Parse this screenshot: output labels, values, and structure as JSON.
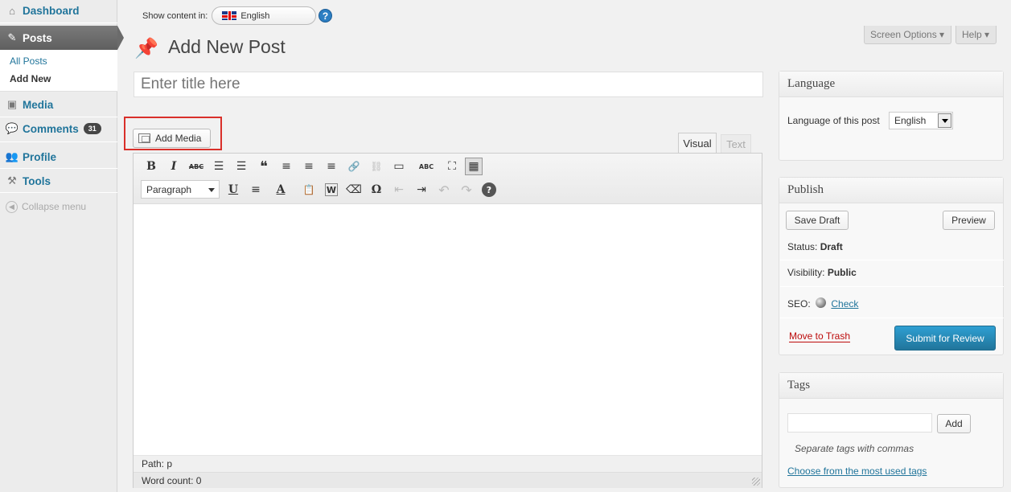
{
  "sidebar": {
    "dashboard": "Dashboard",
    "posts": "Posts",
    "all_posts": "All Posts",
    "add_new": "Add New",
    "media": "Media",
    "comments": "Comments",
    "comments_count": "31",
    "profile": "Profile",
    "tools": "Tools",
    "collapse": "Collapse menu"
  },
  "topbar": {
    "show_content_label": "Show content in:",
    "language": "English",
    "help_icon": "?",
    "screen_options": "Screen Options ▾",
    "help": "Help ▾"
  },
  "page": {
    "title": "Add New Post",
    "title_placeholder": "Enter title here"
  },
  "editor": {
    "add_media": "Add Media",
    "tab_visual": "Visual",
    "tab_text": "Text",
    "format": "Paragraph",
    "path": "Path: p",
    "word_count": "Word count: 0",
    "buttons": {
      "bold": "B",
      "italic": "I",
      "strike": "ABC",
      "bullets": "☰",
      "numbers": "☰",
      "quote": "❝",
      "align_left": "≡",
      "align_center": "≡",
      "align_right": "≡",
      "link": "🔗",
      "unlink": "⛓",
      "more": "▭",
      "spell": "ABC",
      "fullscreen": "⛶",
      "kitchen": "▦",
      "underline": "U",
      "justify": "≡",
      "text_color": "A",
      "paste_text": "📋",
      "paste_word": "W",
      "clear": "⌫",
      "omega": "Ω",
      "outdent": "⇤",
      "indent": "⇥",
      "undo": "↶",
      "redo": "↷",
      "help": "?"
    }
  },
  "language_box": {
    "title": "Language",
    "label": "Language of this post",
    "value": "English"
  },
  "publish_box": {
    "title": "Publish",
    "save_draft": "Save Draft",
    "preview": "Preview",
    "status_label": "Status:",
    "status_value": "Draft",
    "visibility_label": "Visibility:",
    "visibility_value": "Public",
    "seo_label": "SEO:",
    "seo_link": "Check",
    "trash": "Move to Trash",
    "submit": "Submit for Review"
  },
  "tags_box": {
    "title": "Tags",
    "add": "Add",
    "hint": "Separate tags with commas",
    "most_used": "Choose from the most used tags"
  },
  "colors": {
    "accent": "#21759b",
    "highlight": "#d9302a",
    "trash": "#bc0b0b"
  }
}
